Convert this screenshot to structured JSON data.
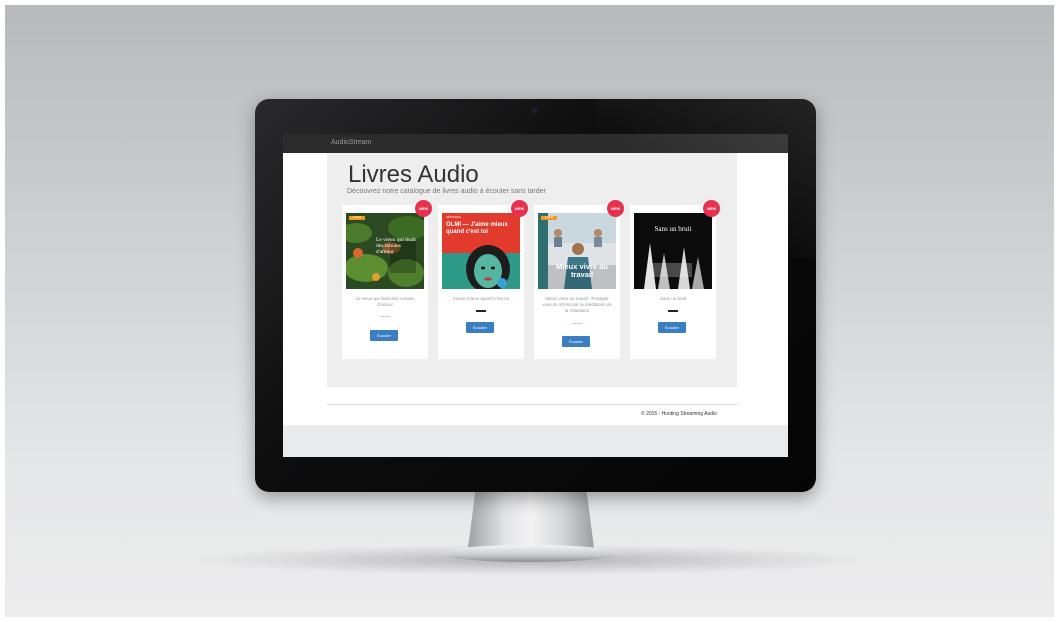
{
  "app": {
    "brand": "AudioStream"
  },
  "hero": {
    "title": "Livres Audio",
    "subtitle": "Découvrez notre catalogue de livres audio à écouter sans tarder"
  },
  "books": [
    {
      "badge": "NEW",
      "publisher": "audiolib",
      "cover_text": "Le vieux qui lisait des romans d'amour",
      "description": "Le vieux qui lisait des romans d'amour",
      "button": "Écouter"
    },
    {
      "badge": "NEW",
      "publisher": "VÉRONIQUE",
      "cover_text": "OLMI — J'aime mieux quand c'est toi",
      "description": "J'aime mieux quand c'est toi",
      "button": "Écouter"
    },
    {
      "badge": "NEW",
      "publisher": "audiolib",
      "cover_text": "Mieux vivre au travail",
      "description": "Mieux vivre au travail : Protéger vous du stress par la méditation de la relaxation",
      "button": "Écouter"
    },
    {
      "badge": "NEW",
      "publisher": "",
      "cover_text": "Sans un bruit",
      "description": "Sans un bruit",
      "button": "Écouter"
    }
  ],
  "footer": {
    "text": "© 2015 - Hunting Streaming Audio"
  },
  "icons": {
    "camera": "camera-icon"
  },
  "colors": {
    "badge": "#e8304f",
    "button": "#3a7ec2",
    "navbar": "#2b2b2b"
  }
}
